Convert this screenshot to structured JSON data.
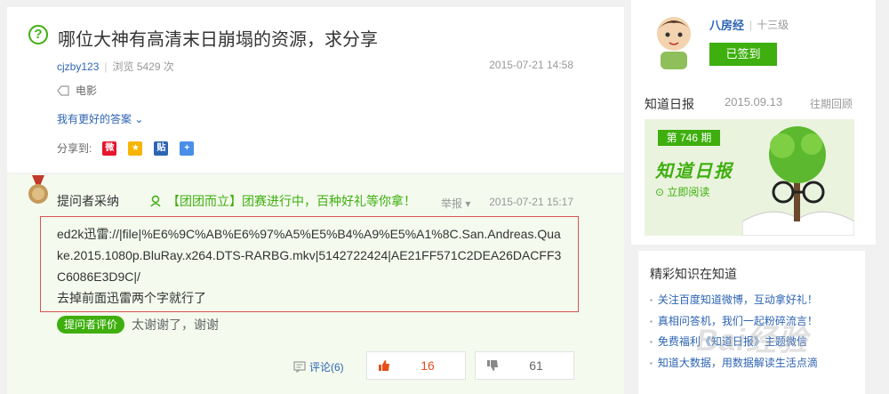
{
  "question": {
    "title": "哪位大神有高清末日崩塌的资源，求分享",
    "user": "cjzby123",
    "views": "浏览 5429 次",
    "date": "2015-07-21 14:58",
    "tag": "电影",
    "better_answer": "我有更好的答案 ⌄",
    "share_label": "分享到:"
  },
  "answer": {
    "heading": "提问者采纳",
    "promo": "【团团而立】团赛进行中，百种好礼等你拿！",
    "report": "举报 ▾",
    "date": "2015-07-21 15:17",
    "content_line1": "ed2k迅雷://|file|%E6%9C%AB%E6%97%A5%E5%B4%A9%E5%A1%8C.San.Andreas.Quake.2015.1080p.BluRay.x264.DTS-RARBG.mkv|5142722424|AE21FF571C2DEA26DACFF3C6086E3D9C|/",
    "content_line2": "去掉前面迅雷两个字就行了",
    "rate_label": "提问者评价",
    "rate_text": "太谢谢了，谢谢",
    "comments": "评论(6)",
    "upvotes": "16",
    "downvotes": "61"
  },
  "profile": {
    "name": "八房经",
    "level": "十三级",
    "signed_label": "已签到"
  },
  "daily": {
    "title": "知道日报",
    "date": "2015.09.13",
    "past": "往期回顾",
    "issue": "第 746 期",
    "banner_title": "知道日报",
    "read_now": "⊙ 立即阅读"
  },
  "featured": {
    "title": "精彩知识在知道",
    "items": [
      "关注百度知道微博，互动拿好礼！",
      "真相问答机，我们一起粉碎流言！",
      "免费福利《知道日报》主题微信",
      "知道大数据，用数据解读生活点滴"
    ]
  },
  "watermark": "Bai经验",
  "colors": {
    "accent_green": "#3eaf0e",
    "link_blue": "#2d64b3",
    "answer_bg": "#f4faee",
    "answer_border": "#d9534f"
  }
}
